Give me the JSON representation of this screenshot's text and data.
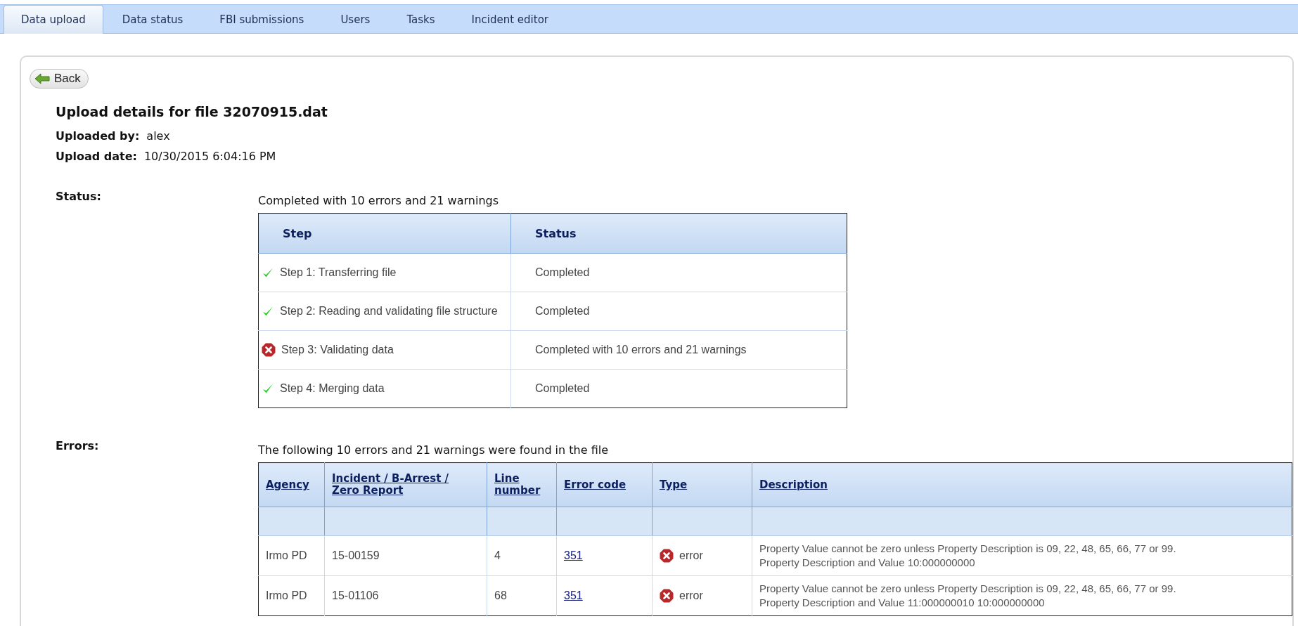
{
  "tabs": [
    {
      "label": "Data upload",
      "selected": true
    },
    {
      "label": "Data status",
      "selected": false
    },
    {
      "label": "FBI submissions",
      "selected": false
    },
    {
      "label": "Users",
      "selected": false
    },
    {
      "label": "Tasks",
      "selected": false
    },
    {
      "label": "Incident editor",
      "selected": false
    }
  ],
  "back_button": "Back",
  "title": "Upload details for file 32070915.dat",
  "details": [
    {
      "label": "Uploaded by:",
      "value": "alex"
    },
    {
      "label": "Upload date:",
      "value": "10/30/2015 6:04:16 PM"
    }
  ],
  "status_section": {
    "label": "Status:",
    "summary": "Completed with 10 errors and 21 warnings",
    "columns": [
      "Step",
      "Status"
    ],
    "steps": [
      {
        "kind": "ok",
        "step": "Step 1: Transferring file",
        "status": "Completed"
      },
      {
        "kind": "ok",
        "step": "Step 2: Reading and validating file structure",
        "status": "Completed"
      },
      {
        "kind": "error",
        "step": "Step 3: Validating data",
        "status": "Completed with 10 errors and 21 warnings"
      },
      {
        "kind": "ok",
        "step": "Step 4: Merging data",
        "status": "Completed"
      }
    ]
  },
  "errors_section": {
    "label": "Errors:",
    "summary": "The following 10 errors and 21 warnings were found in the file",
    "columns": [
      "Agency",
      "Incident / B-Arrest / Zero Report",
      "Line number",
      "Error code",
      "Type",
      "Description"
    ],
    "rows": [
      {
        "agency": "Irmo PD",
        "incident": "15-00159",
        "line": "4",
        "code": "351",
        "kind": "error",
        "type": "error",
        "description": [
          "Property Value cannot be zero unless Property Description is 09, 22, 48, 65, 66, 77 or 99.",
          "Property Description and Value 10:000000000"
        ]
      },
      {
        "agency": "Irmo PD",
        "incident": "15-01106",
        "line": "68",
        "code": "351",
        "kind": "error",
        "type": "error",
        "description": [
          "Property Value cannot be zero unless Property Description is 09, 22, 48, 65, 66, 77 or 99.",
          "Property Description and Value 11:000000010 10:000000000"
        ]
      }
    ]
  }
}
